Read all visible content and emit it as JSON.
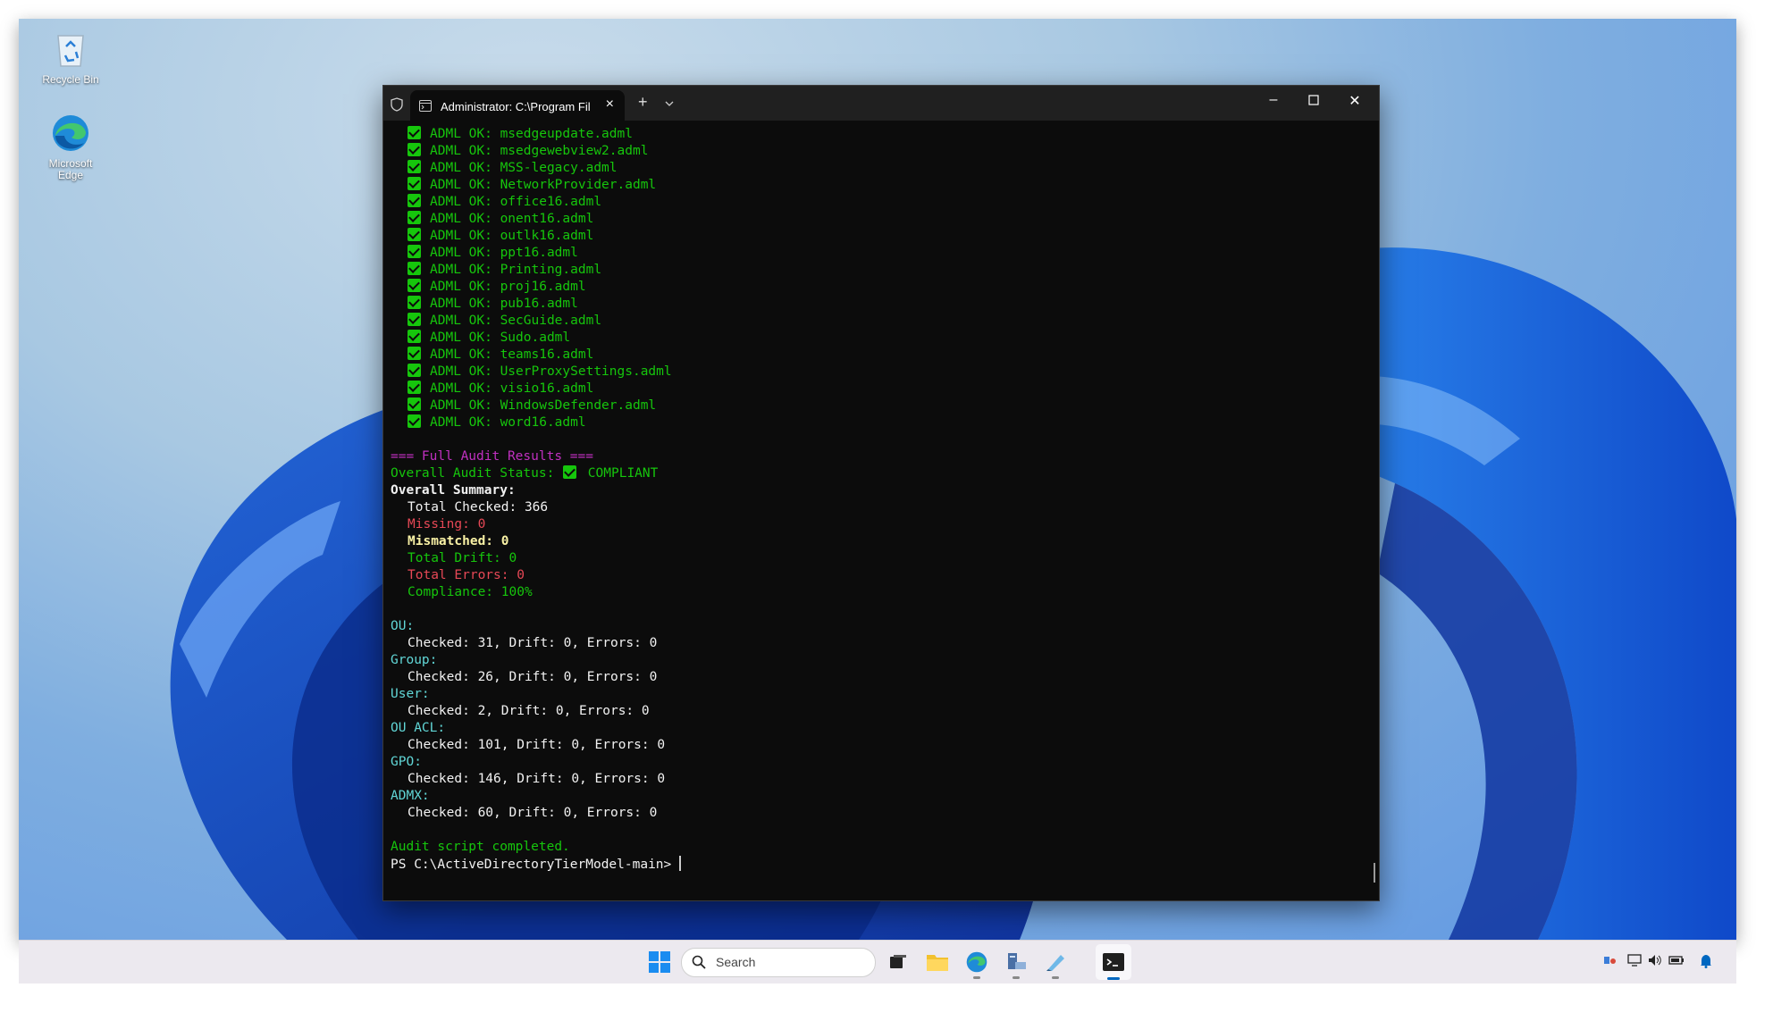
{
  "desktop": {
    "icons": [
      {
        "label": "Recycle Bin",
        "icon": "recycle-bin-icon"
      },
      {
        "label": "Microsoft\nEdge",
        "icon": "edge-icon"
      }
    ]
  },
  "terminal": {
    "tab_title": "Administrator: C:\\Program Fil",
    "adml_lines": [
      "ADML OK: msedgeupdate.adml",
      "ADML OK: msedgewebview2.adml",
      "ADML OK: MSS-legacy.adml",
      "ADML OK: NetworkProvider.adml",
      "ADML OK: office16.adml",
      "ADML OK: onent16.adml",
      "ADML OK: outlk16.adml",
      "ADML OK: ppt16.adml",
      "ADML OK: Printing.adml",
      "ADML OK: proj16.adml",
      "ADML OK: pub16.adml",
      "ADML OK: SecGuide.adml",
      "ADML OK: Sudo.adml",
      "ADML OK: teams16.adml",
      "ADML OK: UserProxySettings.adml",
      "ADML OK: visio16.adml",
      "ADML OK: WindowsDefender.adml",
      "ADML OK: word16.adml"
    ],
    "results_header": "=== Full Audit Results ===",
    "status_label": "Overall Audit Status:",
    "status_value": "COMPLIANT",
    "summary_header": "Overall Summary:",
    "total_checked": "Total Checked: 366",
    "missing": "Missing: 0",
    "mismatched": "Mismatched: 0",
    "total_drift": "Total Drift: 0",
    "total_errors": "Total Errors: 0",
    "compliance": "Compliance: 100%",
    "sections": [
      {
        "name": "OU:",
        "detail": "Checked: 31, Drift: 0, Errors: 0"
      },
      {
        "name": "Group:",
        "detail": "Checked: 26, Drift: 0, Errors: 0"
      },
      {
        "name": "User:",
        "detail": "Checked: 2, Drift: 0, Errors: 0"
      },
      {
        "name": "OU ACL:",
        "detail": "Checked: 101, Drift: 0, Errors: 0"
      },
      {
        "name": "GPO:",
        "detail": "Checked: 146, Drift: 0, Errors: 0"
      },
      {
        "name": "ADMX:",
        "detail": "Checked: 60, Drift: 0, Errors: 0"
      }
    ],
    "completed": "Audit script completed.",
    "prompt": "PS C:\\ActiveDirectoryTierModel-main> "
  },
  "taskbar": {
    "search_placeholder": "Search"
  },
  "colors": {
    "terminal_bg": "#0c0c0c",
    "ok_green": "#16c60c",
    "header_magenta": "#c030c0",
    "error_red": "#e74856",
    "warn_yellow": "#f9f1a5",
    "section_cyan": "#61d6d6"
  }
}
